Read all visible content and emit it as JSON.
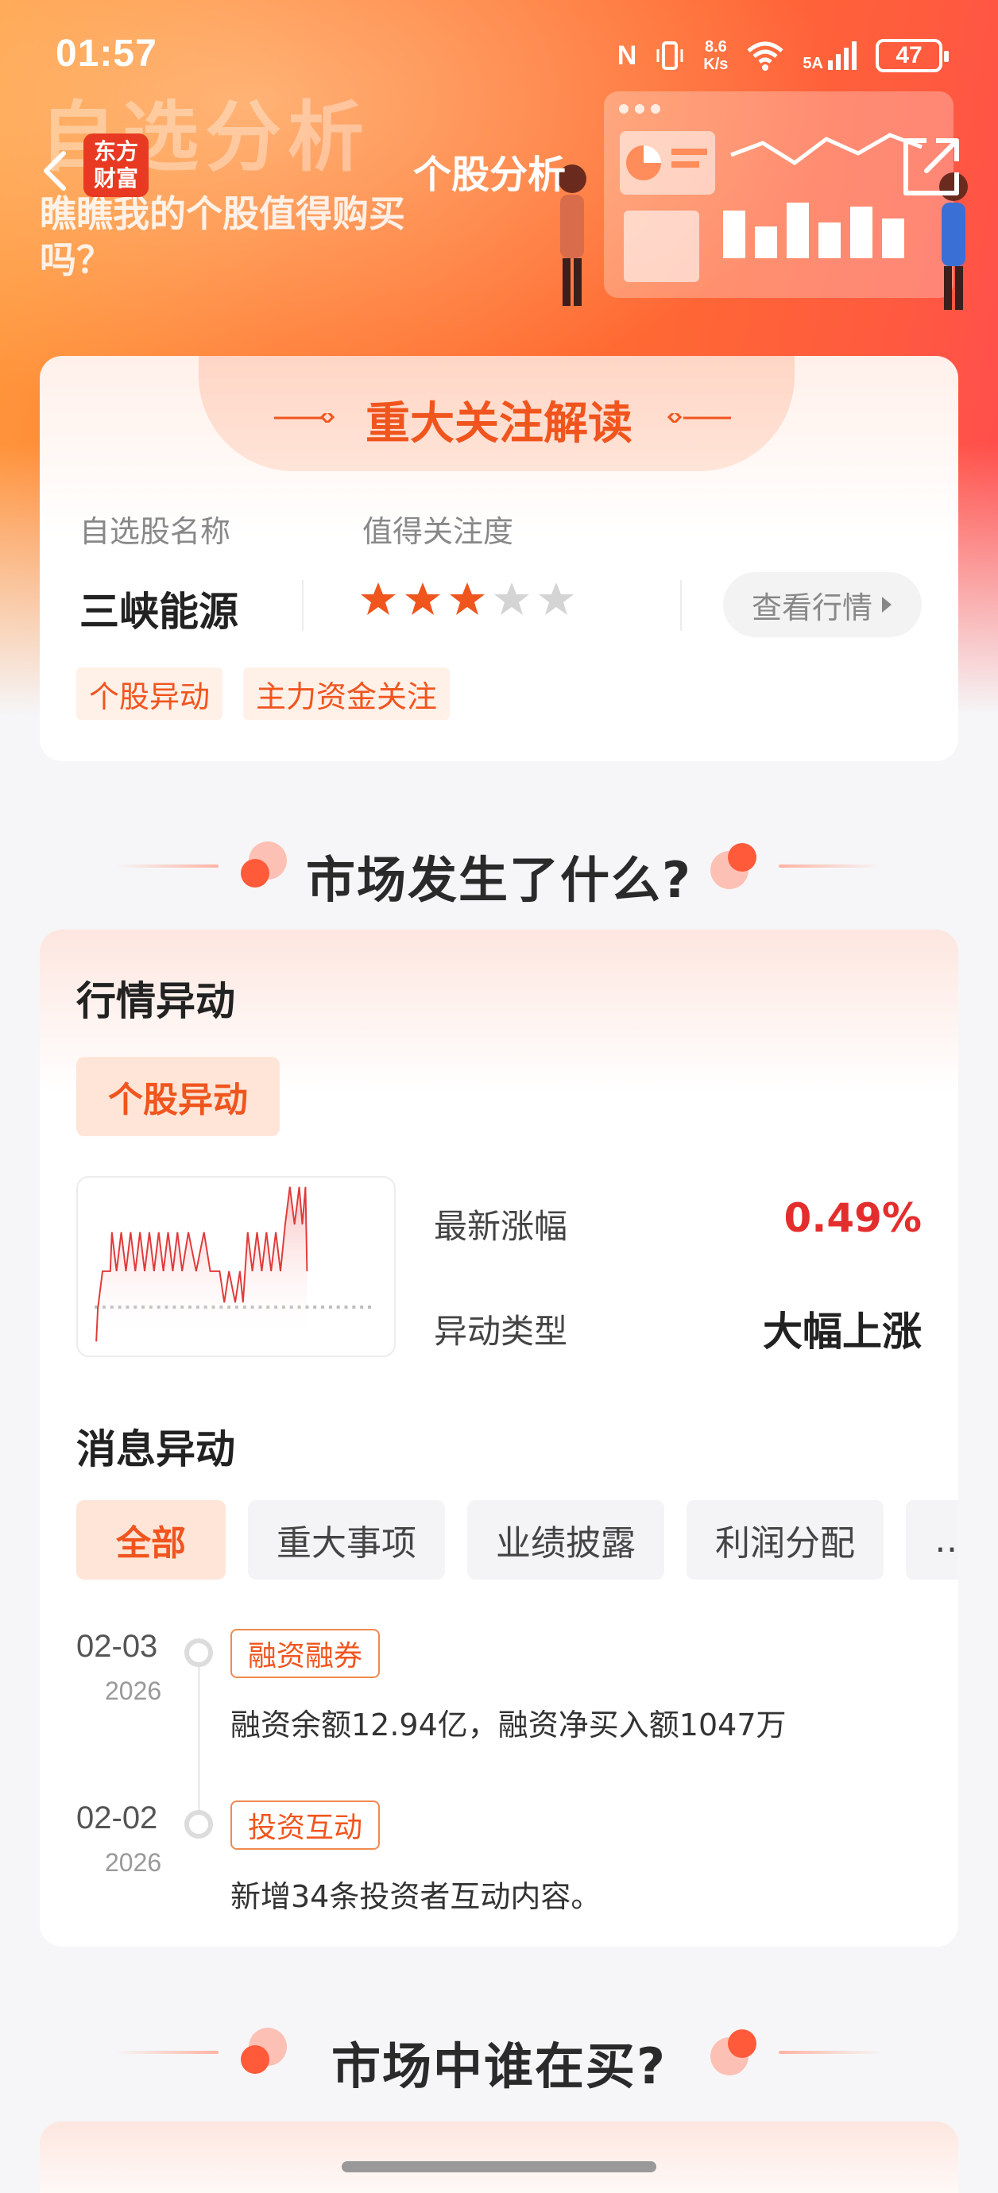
{
  "status_bar": {
    "time": "01:57",
    "nfc": "N",
    "speed_value": "8.6",
    "speed_unit": "K/s",
    "network": "5A",
    "battery": "47"
  },
  "header": {
    "watermark_title": "自选分析",
    "watermark_subtitle": "瞧瞧我的个股值得购买吗？",
    "logo_line1": "东方",
    "logo_line2": "财富",
    "title": "个股分析"
  },
  "focus_card": {
    "title": "重大关注解读",
    "name_label": "自选股名称",
    "attention_label": "值得关注度",
    "stock_name": "三峡能源",
    "rating": 3,
    "rating_max": 5,
    "quote_button": "查看行情",
    "tags": [
      "个股异动",
      "主力资金关注"
    ]
  },
  "section1": {
    "title": "市场发生了什么?"
  },
  "market_card": {
    "heading": "行情异动",
    "pill": "个股异动",
    "latest_change_label": "最新涨幅",
    "latest_change_value": "0.49%",
    "type_label": "异动类型",
    "type_value": "大幅上涨",
    "news_heading": "消息异动",
    "filters": [
      "全部",
      "重大事项",
      "业绩披露",
      "利润分配",
      "…"
    ],
    "events": [
      {
        "date": "02-03",
        "year": "2026",
        "tag": "融资融券",
        "text": "融资余额12.94亿，融资净买入额1047万"
      },
      {
        "date": "02-02",
        "year": "2026",
        "tag": "投资互动",
        "text": "新增34条投资者互动内容。"
      }
    ]
  },
  "section2": {
    "title": "市场中谁在买?"
  },
  "colors": {
    "accent": "#f0551e",
    "up_red": "#e42e2e",
    "banner_start": "#ff9a3c",
    "banner_end": "#ff4a50"
  }
}
